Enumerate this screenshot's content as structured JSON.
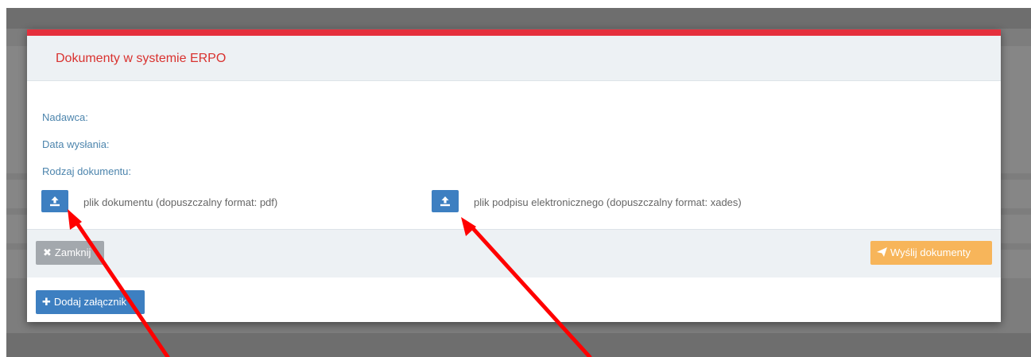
{
  "modal": {
    "title": "Dokumenty w systemie ERPO",
    "fields": {
      "sender_label": "Nadawca:",
      "date_label": "Data wysłania:",
      "doc_type_label": "Rodzaj dokumentu:"
    },
    "uploads": {
      "document_label": "plik dokumentu (dopuszczalny format: pdf)",
      "signature_label": "plik podpisu elektronicznego (dopuszczalny format: xades)"
    },
    "footer": {
      "close_label": "Zamknij",
      "send_label": "Wyślij dokumenty"
    },
    "add_attachment_label": "Dodaj załącznik"
  },
  "colors": {
    "accent_red": "#e5303d",
    "primary_blue": "#3d7fc1",
    "warning_orange": "#f7b55a",
    "label_blue": "#4d85ad",
    "annotation_arrow": "#ff0000"
  },
  "icons": {
    "upload": "upload-icon",
    "close": "times-icon",
    "send": "paper-plane-icon",
    "add": "plus-icon"
  }
}
